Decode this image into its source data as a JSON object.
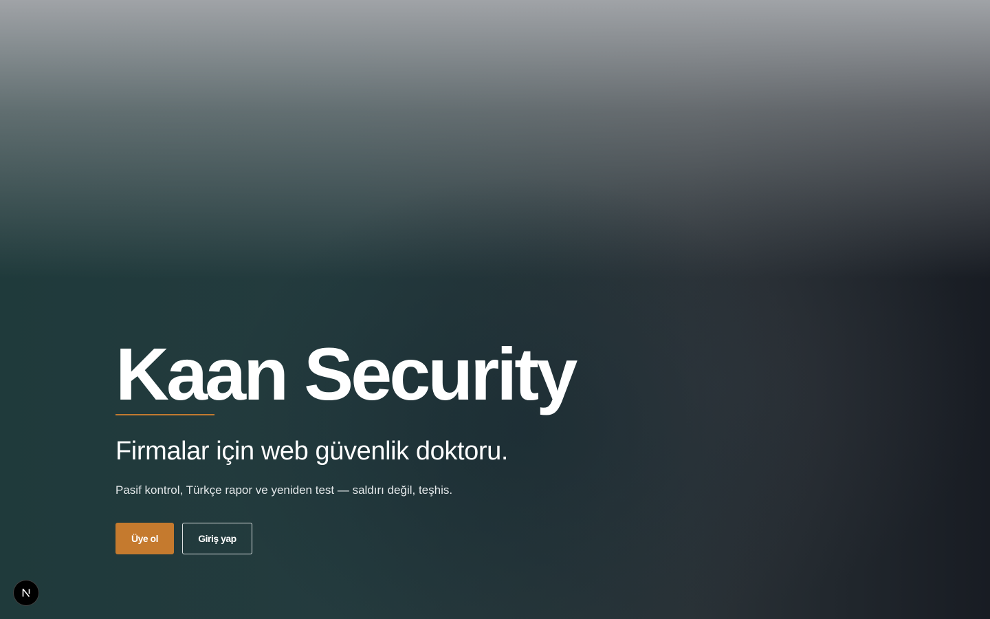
{
  "hero": {
    "title": "Kaan Security",
    "tagline": "Firmalar için web güvenlik doktoru.",
    "subline": "Pasif kontrol, Türkçe rapor ve yeniden test — saldırı değil, teşhis."
  },
  "actions": {
    "signup_label": "Üye ol",
    "login_label": "Giriş yap"
  },
  "devtools": {
    "icon": "nextjs-logo-icon"
  },
  "colors": {
    "accent": "#c57a2e",
    "title_text": "#ffffff"
  }
}
